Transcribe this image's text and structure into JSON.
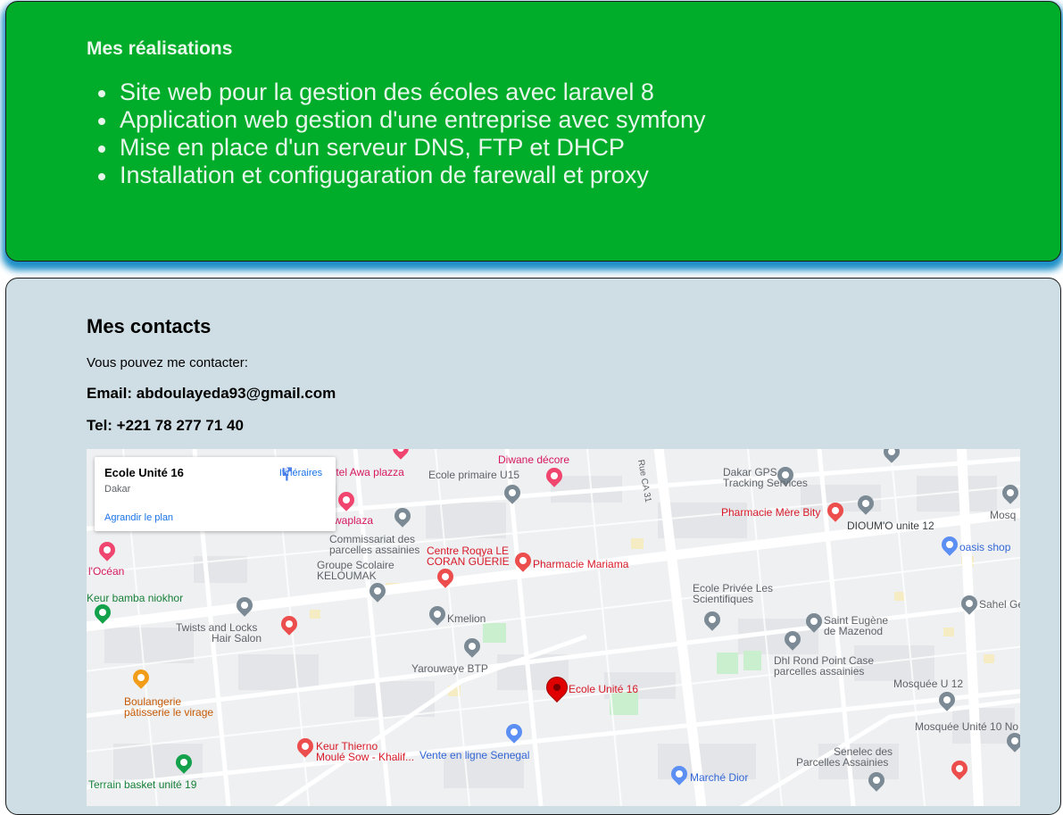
{
  "achievements": {
    "heading": "Mes réalisations",
    "items": [
      "Site web pour la gestion des écoles avec laravel 8",
      "Application web gestion d'une entreprise avec symfony",
      "Mise en place d'un serveur DNS, FTP et DHCP",
      "Installation et configugaration de farewall et proxy"
    ]
  },
  "contacts": {
    "heading": "Mes contacts",
    "intro": "Vous pouvez me contacter:",
    "email": "Email: abdoulayeda93@gmail.com",
    "tel": "Tel: +221 78 277 71 40"
  },
  "map": {
    "infobox": {
      "place_name": "Ecole Unité 16",
      "city": "Dakar",
      "directions_label": "Itinéraires",
      "enlarge_label": "Agrandir le plan"
    },
    "labels": {
      "hotel_awa_plazza": "hôtel Awa plazza",
      "awaplaza": "waplaza",
      "diwane_decore": "Diwane décore",
      "ecole_primaire_u15": "Ecole primaire U15",
      "dakar_gps_1": "Dakar GPS",
      "dakar_gps_2": "Tracking Services",
      "pharmacie_mere_bity": "Pharmacie Mère Bity",
      "dioumo": "DIOUM'O unite 12",
      "oasis_shop": "oasis shop",
      "mosq": "Mosq",
      "commissariat_1": "Commissariat des",
      "commissariat_2": "parcelles assainies",
      "centre_roqya_1": "Centre Roqya LE",
      "centre_roqya_2": "CORAN GUERIE",
      "pharmacie_mariama": "Pharmacie Mariama",
      "groupe_scolaire_1": "Groupe Scolaire",
      "groupe_scolaire_2": "KELOUMAK",
      "l_ocean": "l'Océan",
      "keur_bamba": "Keur bamba niokhor",
      "kmelion": "Kmelion",
      "twists_1": "Twists and Locks",
      "twists_2": "Hair Salon",
      "ecole_privee_1": "Ecole Privée Les",
      "ecole_privee_2": "Scientifiques",
      "saint_eugene_1": "Saint Eugène",
      "saint_eugene_2": "de Mazenod",
      "sahel": "Sahel Ge",
      "dhl_1": "Dhl Rond Point Case",
      "dhl_2": "parcelles assainies",
      "yarouwaye": "Yarouwaye BTP",
      "ecole_unite_16": "Ecole Unité 16",
      "mosquee_u12": "Mosquée U 12",
      "mosquee_unite_10": "Mosquée Unité 10 No",
      "boulangerie_1": "Boulangerie",
      "boulangerie_2": "pâtisserie le virage",
      "keur_thierno_1": "Keur Thierno",
      "keur_thierno_2": "Moulé Sow - Khalif...",
      "vente_en_ligne": "Vente en ligne Senegal",
      "senelec_1": "Senelec des",
      "senelec_2": "Parcelles Assainies",
      "marche_dior": "Marché Dior",
      "terrain_basket": "Terrain basket unité 19",
      "rue_ca_31": "Rue CA 31"
    }
  }
}
